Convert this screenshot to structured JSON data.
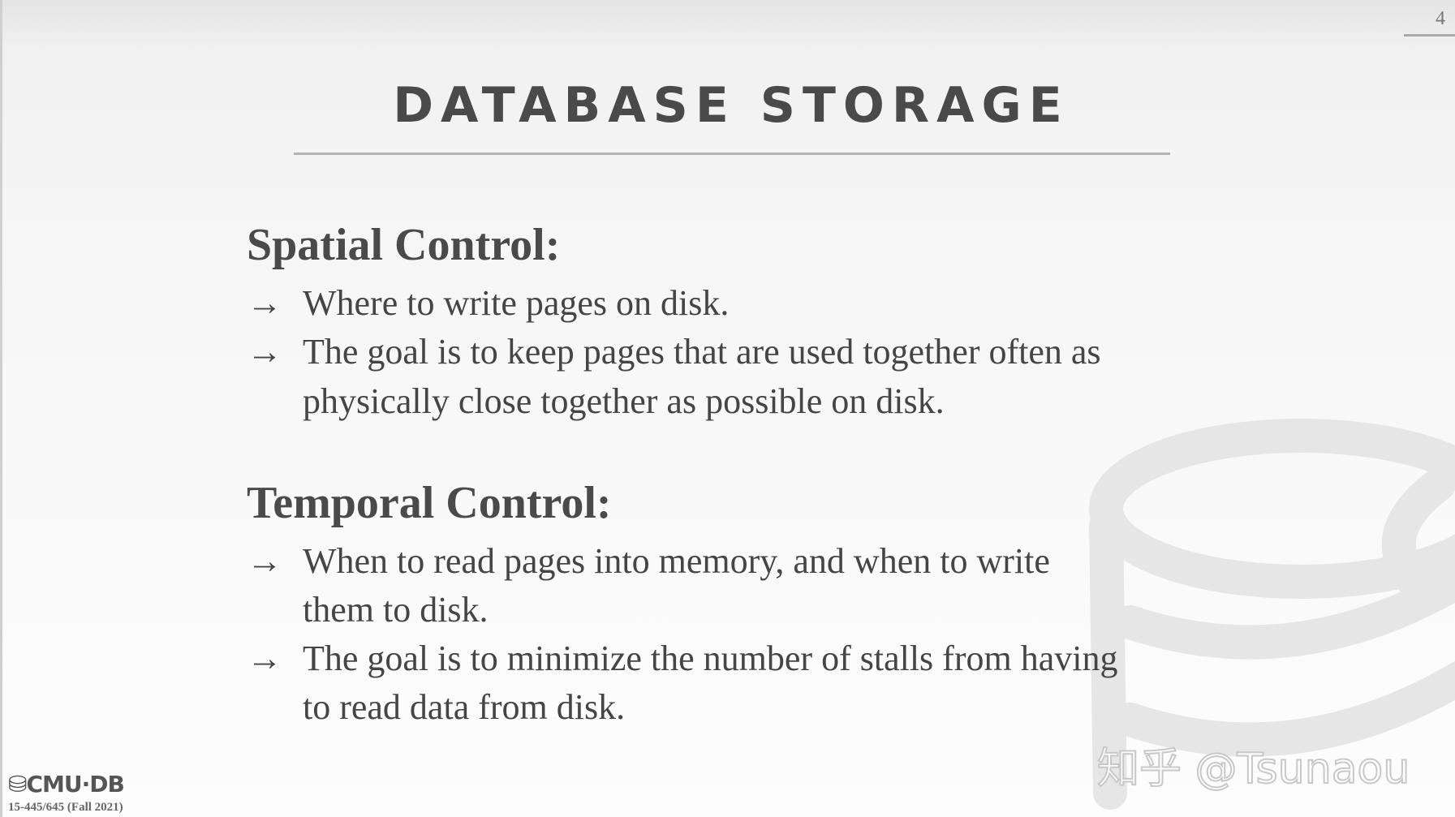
{
  "slide": {
    "page_number": "4",
    "title": "DATABASE STORAGE"
  },
  "sections": [
    {
      "heading": "Spatial Control:",
      "bullets": [
        [
          "Where to write pages on disk."
        ],
        [
          "The goal is to keep pages that are used together often as",
          "physically close together as possible on disk."
        ]
      ]
    },
    {
      "heading": "Temporal Control:",
      "bullets": [
        [
          "When to read pages into memory, and when to write",
          "them to disk."
        ],
        [
          "The goal is to minimize the number of stalls from having",
          "to read data from disk."
        ]
      ]
    }
  ],
  "arrow": "→",
  "footer": {
    "brand": "CMU·DB",
    "course": "15-445/645 (Fall 2021)"
  },
  "watermark": "知乎 @Tsunaou"
}
